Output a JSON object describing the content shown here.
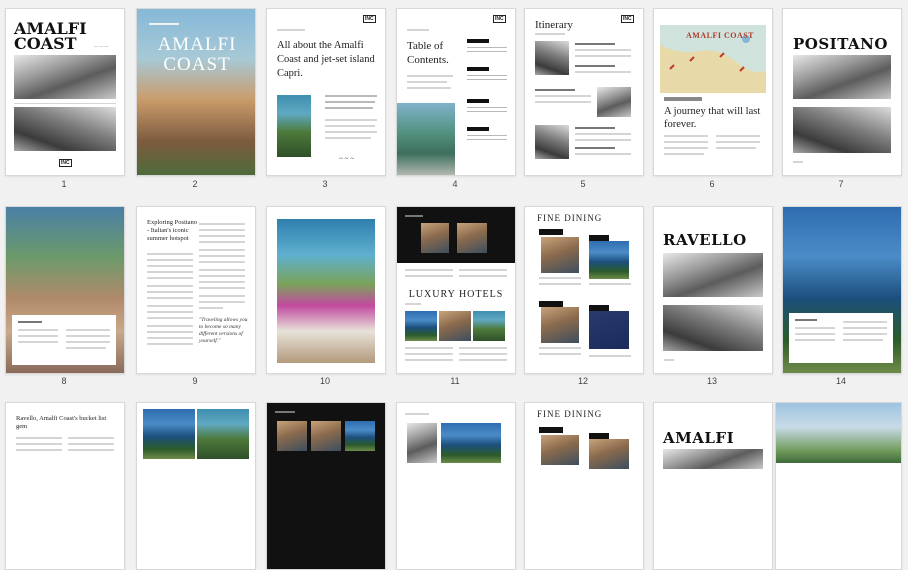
{
  "pages": [
    {
      "number": "1",
      "title": "AMALFI COAST",
      "badge": "INC"
    },
    {
      "number": "2",
      "title": "AMALFI COAST"
    },
    {
      "number": "3",
      "heading": "All about the Amalfi Coast and jet-set island Capri.",
      "badge": "INC"
    },
    {
      "number": "4",
      "heading": "Table of Contents.",
      "badge": "INC"
    },
    {
      "number": "5",
      "heading": "Itinerary",
      "badge": "INC"
    },
    {
      "number": "6",
      "map_title": "AMALFI COAST",
      "heading": "A journey that will last forever."
    },
    {
      "number": "7",
      "title": "POSITANO"
    },
    {
      "number": "8"
    },
    {
      "number": "9",
      "heading": "Exploring Positano - Italian's iconic summer hotspot",
      "quote": "\"Traveling allows you to become so many different versions of yourself.\""
    },
    {
      "number": "10"
    },
    {
      "number": "11",
      "heading": "LUXURY HOTELS"
    },
    {
      "number": "12",
      "heading": "FINE DINING"
    },
    {
      "number": "13",
      "title": "RAVELLO"
    },
    {
      "number": "14"
    },
    {
      "heading": "Ravello, Amalfi Coast's bucket list gem"
    },
    {},
    {},
    {},
    {
      "heading": "FINE DINING"
    },
    {
      "title": "AMALFI"
    },
    {}
  ]
}
